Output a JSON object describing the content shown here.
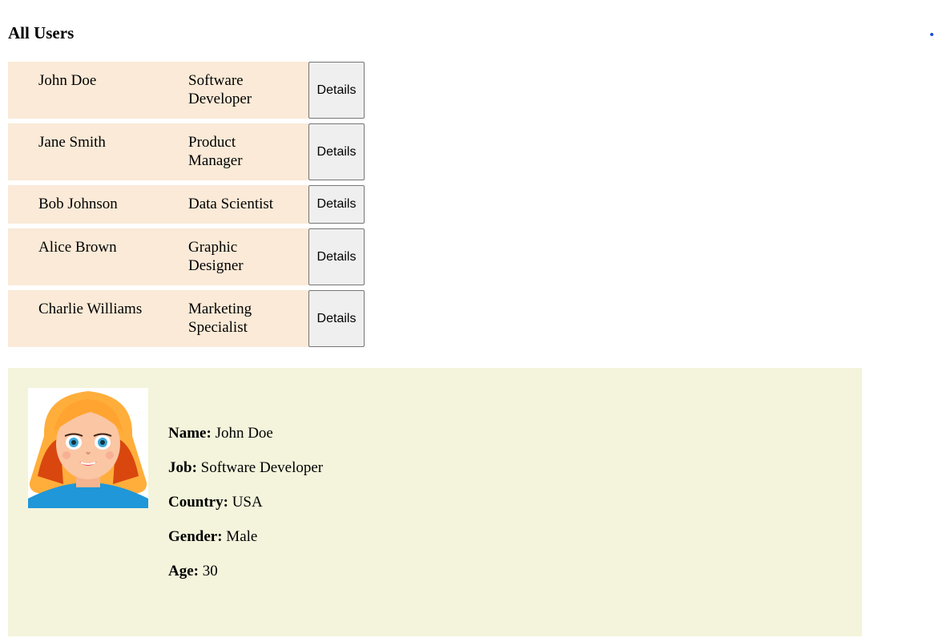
{
  "page": {
    "title": "All Users",
    "accent": "#1f4fd8"
  },
  "colors": {
    "row_background": "#faead7",
    "panel_background": "#f4f4dc",
    "button_background": "#efefef"
  },
  "users": [
    {
      "name": "John Doe",
      "job": "Software Developer",
      "button_label": "Details"
    },
    {
      "name": "Jane Smith",
      "job": "Product Manager",
      "button_label": "Details"
    },
    {
      "name": "Bob Johnson",
      "job": "Data Scientist",
      "button_label": "Details"
    },
    {
      "name": "Alice Brown",
      "job": "Graphic Designer",
      "button_label": "Details"
    },
    {
      "name": "Charlie Williams",
      "job": "Marketing Specialist",
      "button_label": "Details"
    }
  ],
  "selected_user": {
    "avatar_icon": "cartoon-avatar-icon",
    "fields": [
      {
        "label": "Name:",
        "value": "John Doe"
      },
      {
        "label": "Job:",
        "value": "Software Developer"
      },
      {
        "label": "Country:",
        "value": "USA"
      },
      {
        "label": "Gender:",
        "value": "Male"
      },
      {
        "label": "Age:",
        "value": "30"
      }
    ]
  }
}
